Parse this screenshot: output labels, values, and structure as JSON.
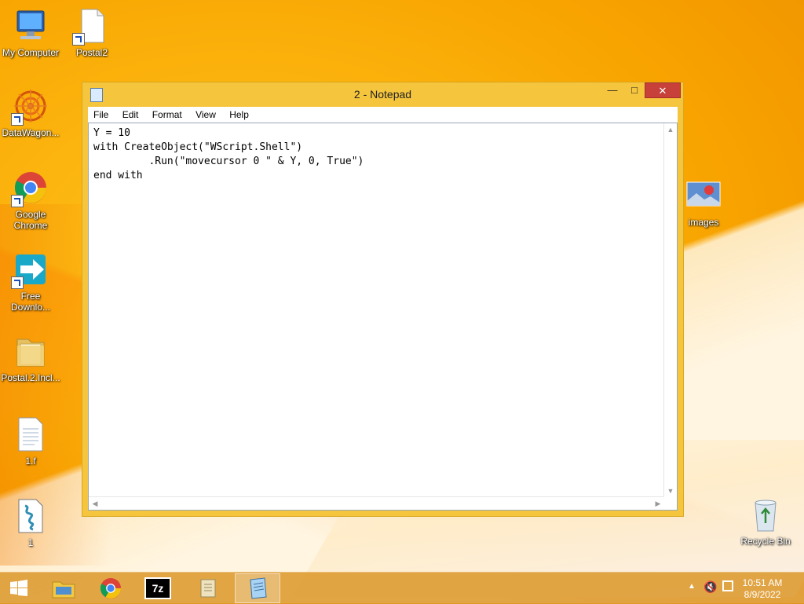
{
  "desktop": {
    "icons": [
      {
        "label": "My Computer",
        "icon": "computer-icon"
      },
      {
        "label": "Postal2",
        "icon": "file-shortcut-icon"
      },
      {
        "label": "DataWagon...",
        "icon": "datawagon-icon"
      },
      {
        "label": "Google Chrome",
        "icon": "chrome-icon"
      },
      {
        "label": "Free Downlo...",
        "icon": "download-manager-icon"
      },
      {
        "label": "Postal.2.Incl...",
        "icon": "folder-icon"
      },
      {
        "label": "1.f",
        "icon": "text-file-icon"
      },
      {
        "label": "1",
        "icon": "script-file-icon"
      },
      {
        "label": "images",
        "icon": "image-file-icon"
      },
      {
        "label": "Recycle Bin",
        "icon": "recycle-bin-icon"
      }
    ]
  },
  "notepad": {
    "title": "2 - Notepad",
    "menu": [
      "File",
      "Edit",
      "Format",
      "View",
      "Help"
    ],
    "content": "Y = 10\nwith CreateObject(\"WScript.Shell\")\n         .Run(\"movecursor 0 \" & Y, 0, True\")\nend with"
  },
  "taskbar": {
    "time": "10:51 AM",
    "date": "8/9/2022",
    "apps": [
      "file-explorer",
      "chrome",
      "7zip",
      "scroll-app",
      "notepad"
    ]
  },
  "colors": {
    "accent": "#f5c53d",
    "close": "#c7403a",
    "taskbar": "#dc9628"
  }
}
